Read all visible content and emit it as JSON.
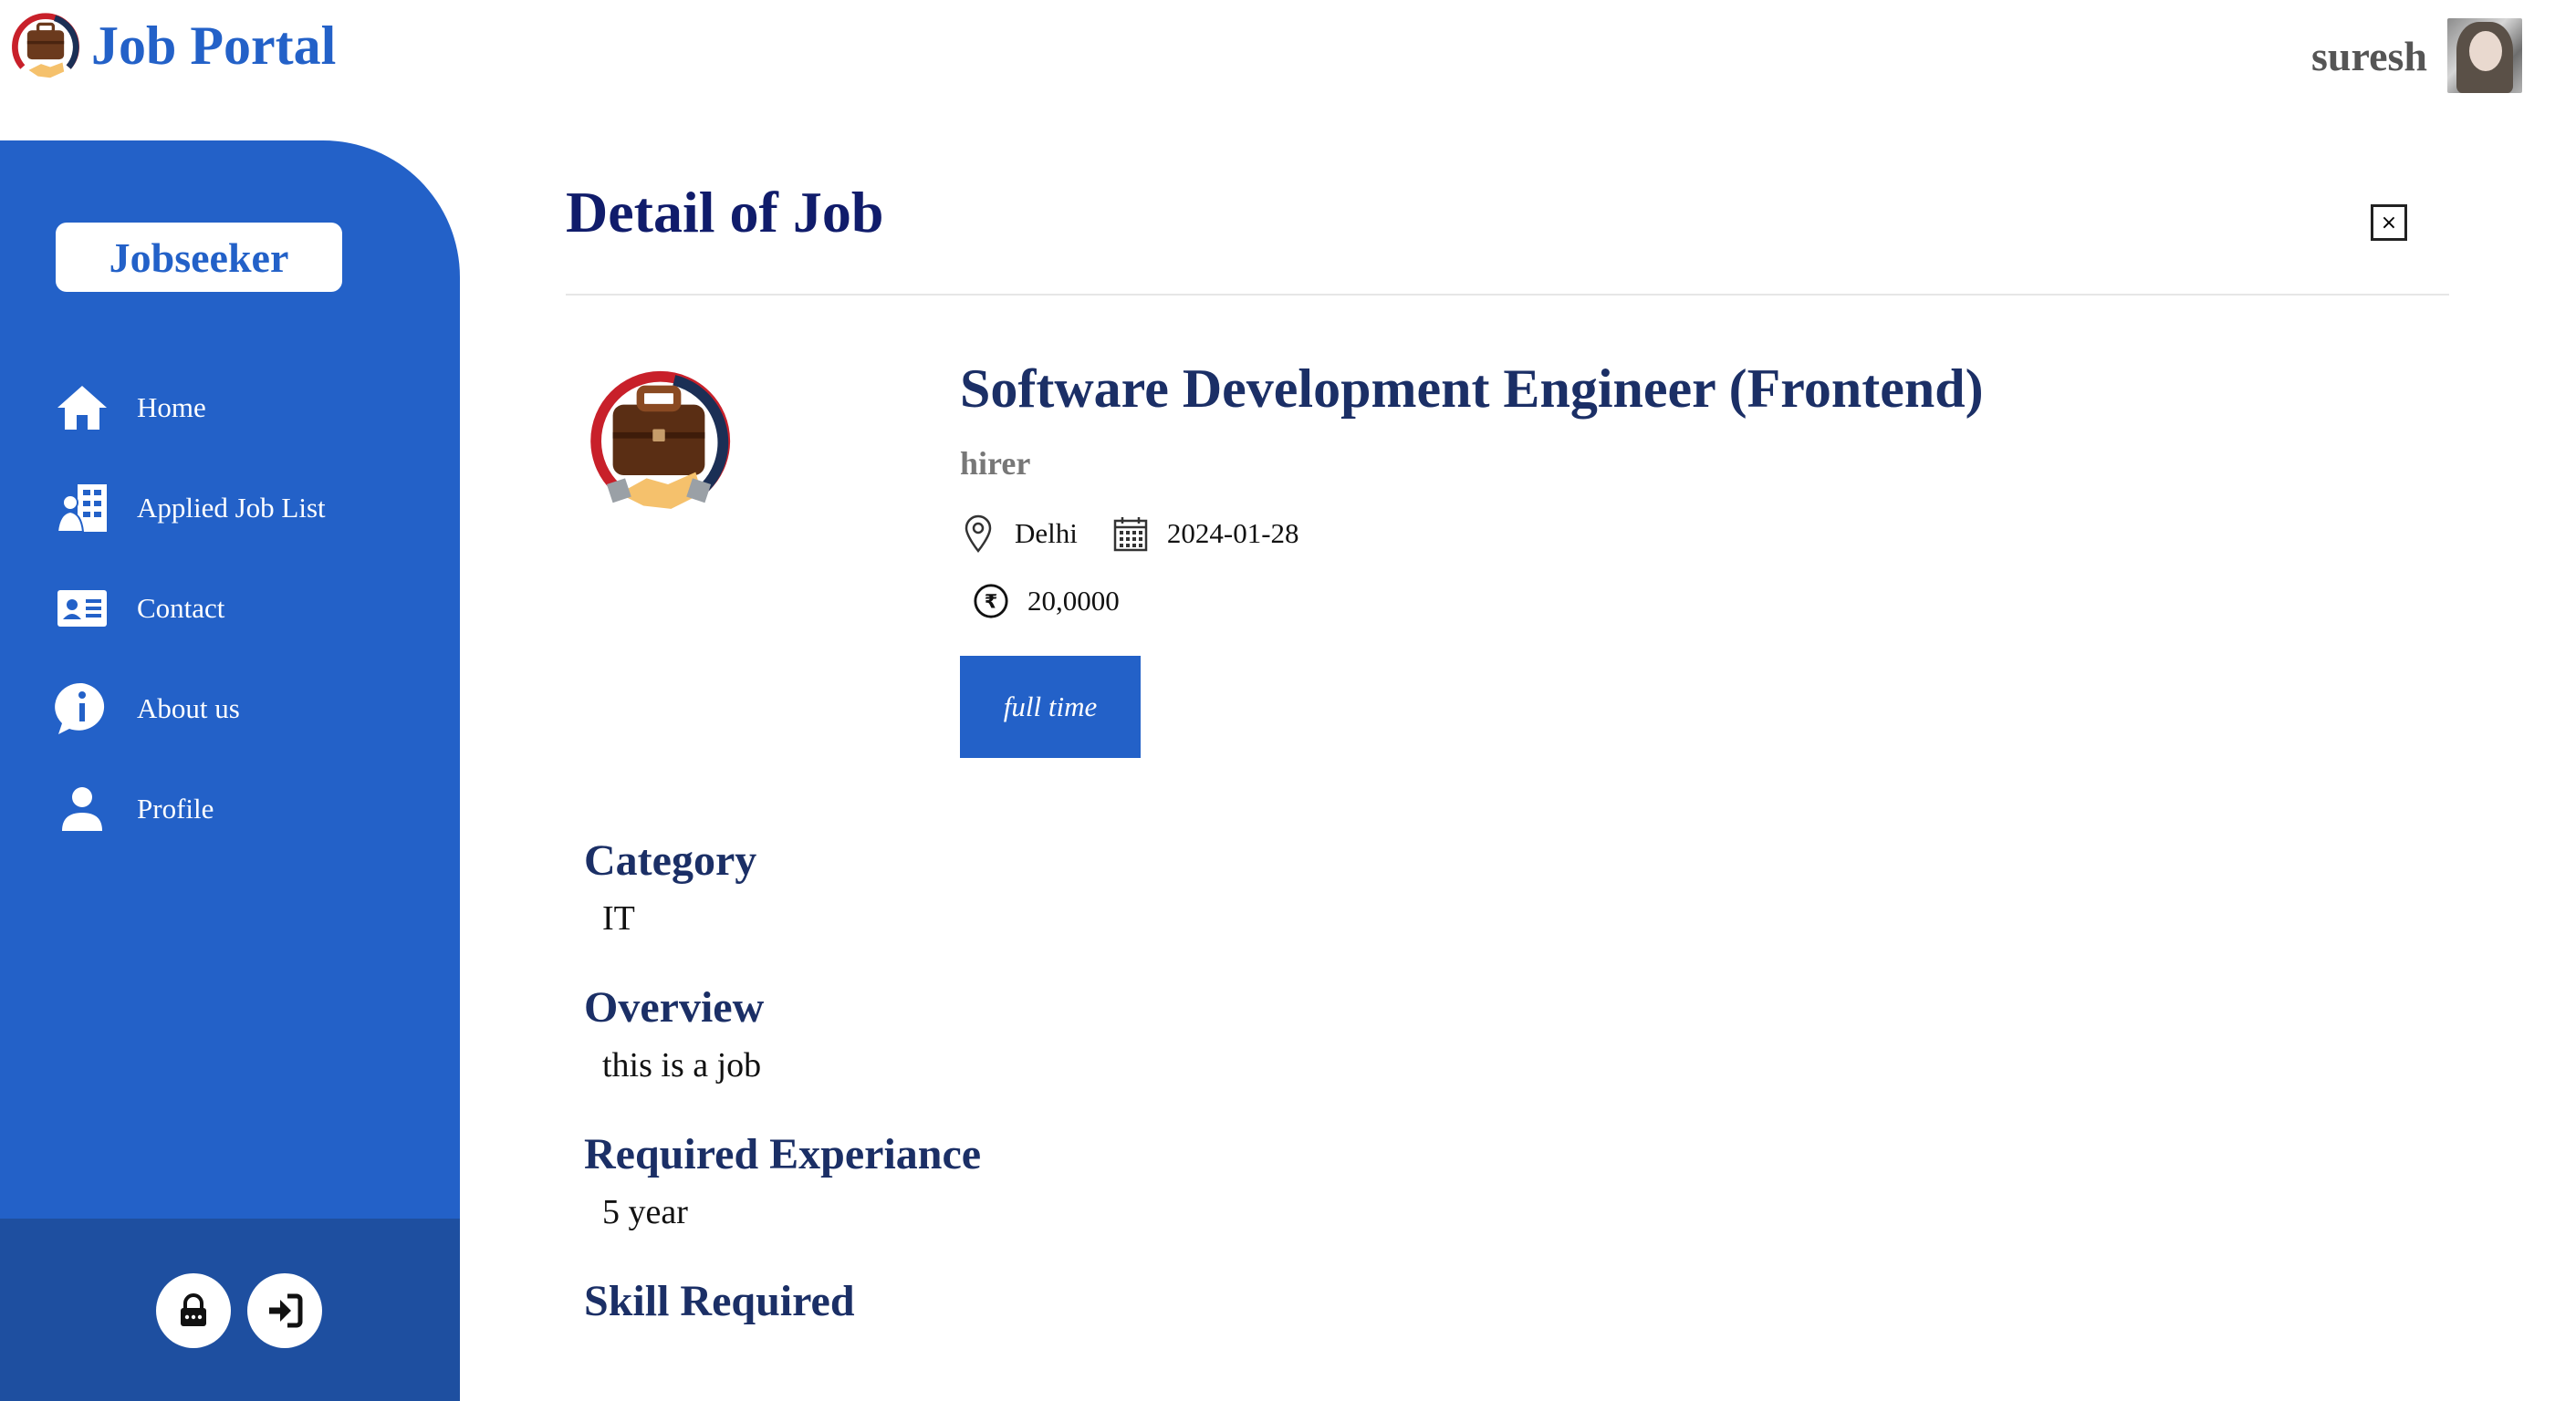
{
  "header": {
    "app_title": "Job Portal",
    "user_name": "suresh",
    "logo_icon": "briefcase-handshake-logo",
    "avatar_icon": "user-avatar-photo"
  },
  "sidebar": {
    "role": "Jobseeker",
    "items": [
      {
        "label": "Home",
        "icon": "home-icon"
      },
      {
        "label": "Applied Job List",
        "icon": "applied-list-icon"
      },
      {
        "label": "Contact",
        "icon": "contact-card-icon"
      },
      {
        "label": "About us",
        "icon": "info-icon"
      },
      {
        "label": "Profile",
        "icon": "user-icon"
      }
    ],
    "footer": {
      "lock_icon": "lock-icon",
      "logout_icon": "logout-icon"
    }
  },
  "main": {
    "page_title": "Detail of Job",
    "close_label": "×",
    "job": {
      "title": "Software Development Engineer (Frontend)",
      "company": "hirer",
      "location": "Delhi",
      "date": "2024-01-28",
      "salary": "20,0000",
      "type": "full time"
    },
    "sections": [
      {
        "title": "Category",
        "value": "IT"
      },
      {
        "title": "Overview",
        "value": "this is a job"
      },
      {
        "title": "Required Experiance",
        "value": "5 year"
      },
      {
        "title": "Skill Required",
        "value": ""
      }
    ]
  },
  "colors": {
    "primary": "#2361c8",
    "sidebar_footer": "#1e4fa0",
    "heading_dark": "#101c6b",
    "text_navy": "#1b2f66",
    "muted": "#777777"
  }
}
